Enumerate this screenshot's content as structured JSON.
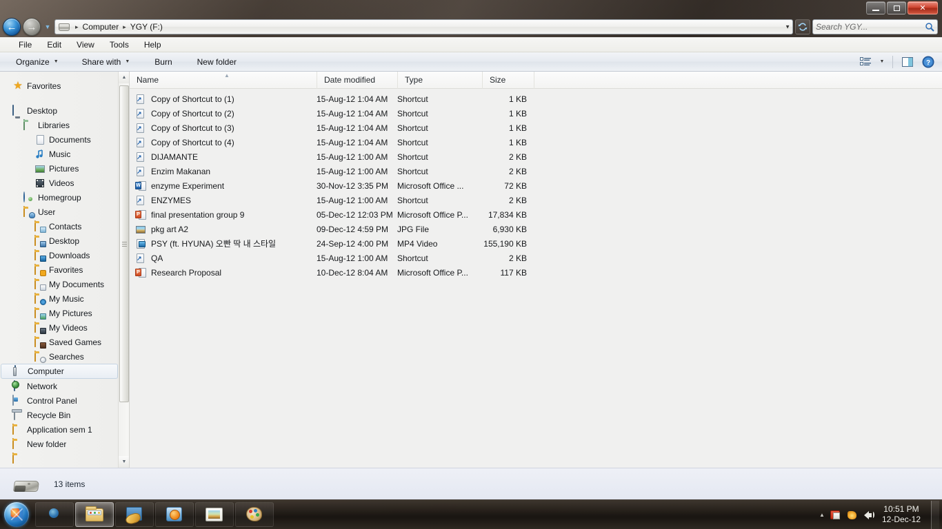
{
  "window": {
    "title_buttons": {
      "minimize": "minimize-icon",
      "maximize": "maximize-icon",
      "close": "✕"
    }
  },
  "address": {
    "back_glyph": "←",
    "forward_glyph": "→",
    "history_glyph": "▼",
    "drive_icon": "removable-drive-icon",
    "breadcrumbs": [
      "Computer",
      "YGY (F:)"
    ],
    "separator": "▸",
    "dropdown_glyph": "▼",
    "refresh_glyph": "↻"
  },
  "search": {
    "placeholder": "Search YGY...",
    "icon": "search-icon"
  },
  "menubar": {
    "items": [
      "File",
      "Edit",
      "View",
      "Tools",
      "Help"
    ]
  },
  "toolbar": {
    "organize": "Organize",
    "share_with": "Share with",
    "burn": "Burn",
    "new_folder": "New folder",
    "caret": "▼",
    "view_icon": "change-view-icon",
    "preview_icon": "preview-pane-icon",
    "help_icon": "help-icon"
  },
  "navigation": {
    "favorites_header": "Favorites",
    "items": [
      {
        "label": "Desktop",
        "icon": "monitor-icon",
        "indent": 0
      },
      {
        "label": "Libraries",
        "icon": "library-folder-icon",
        "indent": 1
      },
      {
        "label": "Documents",
        "icon": "documents-icon",
        "indent": 2
      },
      {
        "label": "Music",
        "icon": "music-icon",
        "indent": 2
      },
      {
        "label": "Pictures",
        "icon": "pictures-icon",
        "indent": 2
      },
      {
        "label": "Videos",
        "icon": "videos-icon",
        "indent": 2
      },
      {
        "label": "Homegroup",
        "icon": "homegroup-icon",
        "indent": 1
      },
      {
        "label": "User",
        "icon": "user-folder-icon",
        "indent": 1
      },
      {
        "label": "Contacts",
        "icon": "contacts-icon",
        "indent": 2
      },
      {
        "label": "Desktop",
        "icon": "desktop-folder-icon",
        "indent": 2
      },
      {
        "label": "Downloads",
        "icon": "downloads-icon",
        "indent": 2
      },
      {
        "label": "Favorites",
        "icon": "favorites-folder-icon",
        "indent": 2
      },
      {
        "label": "My Documents",
        "icon": "documents-folder-icon",
        "indent": 2
      },
      {
        "label": "My Music",
        "icon": "music-folder-icon",
        "indent": 2
      },
      {
        "label": "My Pictures",
        "icon": "pictures-folder-icon",
        "indent": 2
      },
      {
        "label": "My Videos",
        "icon": "videos-folder-icon",
        "indent": 2
      },
      {
        "label": "Saved Games",
        "icon": "saved-games-icon",
        "indent": 2
      },
      {
        "label": "Searches",
        "icon": "searches-icon",
        "indent": 2
      },
      {
        "label": "Computer",
        "icon": "computer-icon",
        "indent": 0,
        "selected": true
      },
      {
        "label": "Network",
        "icon": "network-icon",
        "indent": 0
      },
      {
        "label": "Control Panel",
        "icon": "control-panel-icon",
        "indent": 0
      },
      {
        "label": "Recycle Bin",
        "icon": "recycle-bin-icon",
        "indent": 0
      },
      {
        "label": "Application sem 1",
        "icon": "folder-icon",
        "indent": 0
      },
      {
        "label": "New folder",
        "icon": "folder-icon",
        "indent": 0
      }
    ],
    "scrollbar": {
      "up": "▲",
      "down": "▼"
    }
  },
  "columns": {
    "name": "Name",
    "date_modified": "Date modified",
    "type": "Type",
    "size": "Size",
    "sort_indicator": "▲"
  },
  "files": [
    {
      "name": "Copy of Shortcut to (1)",
      "date": "15-Aug-12 1:04 AM",
      "type": "Shortcut",
      "size": "1 KB",
      "icon": "shortcut-icon"
    },
    {
      "name": "Copy of Shortcut to (2)",
      "date": "15-Aug-12 1:04 AM",
      "type": "Shortcut",
      "size": "1 KB",
      "icon": "shortcut-icon"
    },
    {
      "name": "Copy of Shortcut to (3)",
      "date": "15-Aug-12 1:04 AM",
      "type": "Shortcut",
      "size": "1 KB",
      "icon": "shortcut-icon"
    },
    {
      "name": "Copy of Shortcut to (4)",
      "date": "15-Aug-12 1:04 AM",
      "type": "Shortcut",
      "size": "1 KB",
      "icon": "shortcut-icon"
    },
    {
      "name": "DIJAMANTE",
      "date": "15-Aug-12 1:00 AM",
      "type": "Shortcut",
      "size": "2 KB",
      "icon": "shortcut-icon"
    },
    {
      "name": "Enzim Makanan",
      "date": "15-Aug-12 1:00 AM",
      "type": "Shortcut",
      "size": "2 KB",
      "icon": "shortcut-icon"
    },
    {
      "name": "enzyme Experiment",
      "date": "30-Nov-12 3:35 PM",
      "type": "Microsoft Office ...",
      "size": "72 KB",
      "icon": "word-document-icon"
    },
    {
      "name": "ENZYMES",
      "date": "15-Aug-12 1:00 AM",
      "type": "Shortcut",
      "size": "2 KB",
      "icon": "shortcut-icon"
    },
    {
      "name": "final presentation group 9",
      "date": "05-Dec-12 12:03 PM",
      "type": "Microsoft Office P...",
      "size": "17,834 KB",
      "icon": "powerpoint-icon"
    },
    {
      "name": "pkg art A2",
      "date": "09-Dec-12 4:59 PM",
      "type": "JPG File",
      "size": "6,930 KB",
      "icon": "jpg-image-icon"
    },
    {
      "name": "PSY (ft. HYUNA) 오빤 딱 내 스타일",
      "date": "24-Sep-12 4:00 PM",
      "type": "MP4 Video",
      "size": "155,190 KB",
      "icon": "mp4-video-icon"
    },
    {
      "name": "QA",
      "date": "15-Aug-12 1:00 AM",
      "type": "Shortcut",
      "size": "2 KB",
      "icon": "shortcut-icon"
    },
    {
      "name": "Research Proposal",
      "date": "10-Dec-12 8:04 AM",
      "type": "Microsoft Office P...",
      "size": "117 KB",
      "icon": "powerpoint-icon"
    }
  ],
  "status": {
    "item_count": "13 items",
    "drive_icon": "usb-flash-drive-icon"
  },
  "taskbar": {
    "start": "start-orb-icon",
    "tasks": [
      {
        "name": "firefox",
        "icon": "firefox-icon",
        "active": false
      },
      {
        "name": "windows-explorer",
        "icon": "windows-explorer-icon",
        "active": true
      },
      {
        "name": "paint-tool",
        "icon": "paint-tool-icon",
        "active": false
      },
      {
        "name": "media-player",
        "icon": "windows-media-player-icon",
        "active": false
      },
      {
        "name": "photo-viewer",
        "icon": "photo-viewer-icon",
        "active": false
      },
      {
        "name": "paint",
        "icon": "paint-icon",
        "active": false
      }
    ],
    "tray": {
      "expand": "▲",
      "icons": [
        "antivirus-icon",
        "action-center-icon",
        "volume-icon"
      ]
    },
    "clock_time": "10:51 PM",
    "clock_date": "12-Dec-12"
  }
}
